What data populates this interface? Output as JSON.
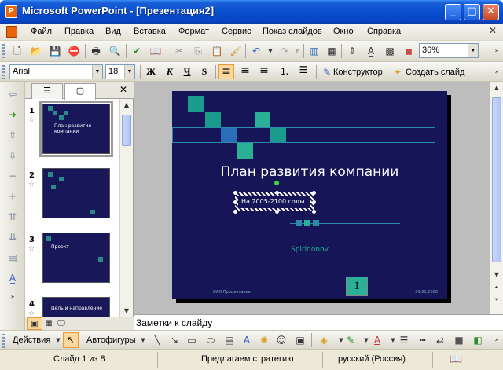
{
  "window": {
    "title": "Microsoft PowerPoint - [Презентация2]",
    "minimize_glyph": "_",
    "maximize_glyph": "□",
    "close_glyph": "✕",
    "app_icon_letter": "P"
  },
  "menu": {
    "items": [
      "Файл",
      "Правка",
      "Вид",
      "Вставка",
      "Формат",
      "Сервис",
      "Показ слайдов",
      "Окно",
      "Справка"
    ],
    "close_glyph": "✕"
  },
  "standard_toolbar": {
    "zoom_value": "36%"
  },
  "format_toolbar": {
    "font_name": "Arial",
    "font_size": "18",
    "bold": "Ж",
    "italic": "К",
    "underline": "Ч",
    "shadow": "S",
    "designer_label": "Конструктор",
    "new_slide_label": "Создать слайд"
  },
  "slides_pane": {
    "tab_close": "✕",
    "slides": [
      {
        "number": "1",
        "title": "План развития компании",
        "selected": true
      },
      {
        "number": "2",
        "title": "",
        "selected": false
      },
      {
        "number": "3",
        "title": "Проект",
        "selected": false
      },
      {
        "number": "4",
        "title": "Цель и направление",
        "selected": false
      }
    ]
  },
  "slide": {
    "title": "План развития компании",
    "subtitle_textbox": "На 2005-2100 годы",
    "author": "Spiridonov",
    "footer_left": "ОАО Процветание",
    "footer_right": "09.01.2006",
    "number": "1",
    "colors": {
      "background": "#151557",
      "teal": "#1a9b8b",
      "blue": "#2a6db8",
      "light_teal": "#29b096"
    }
  },
  "notes": {
    "placeholder": "Заметки к слайду"
  },
  "drawing_toolbar": {
    "actions_label": "Действия",
    "autoshapes_label": "Автофигуры"
  },
  "statusbar": {
    "slide_info": "Слайд 1 из 8",
    "design_name": "Предлагаем стратегию",
    "language": "русский (Россия)"
  }
}
